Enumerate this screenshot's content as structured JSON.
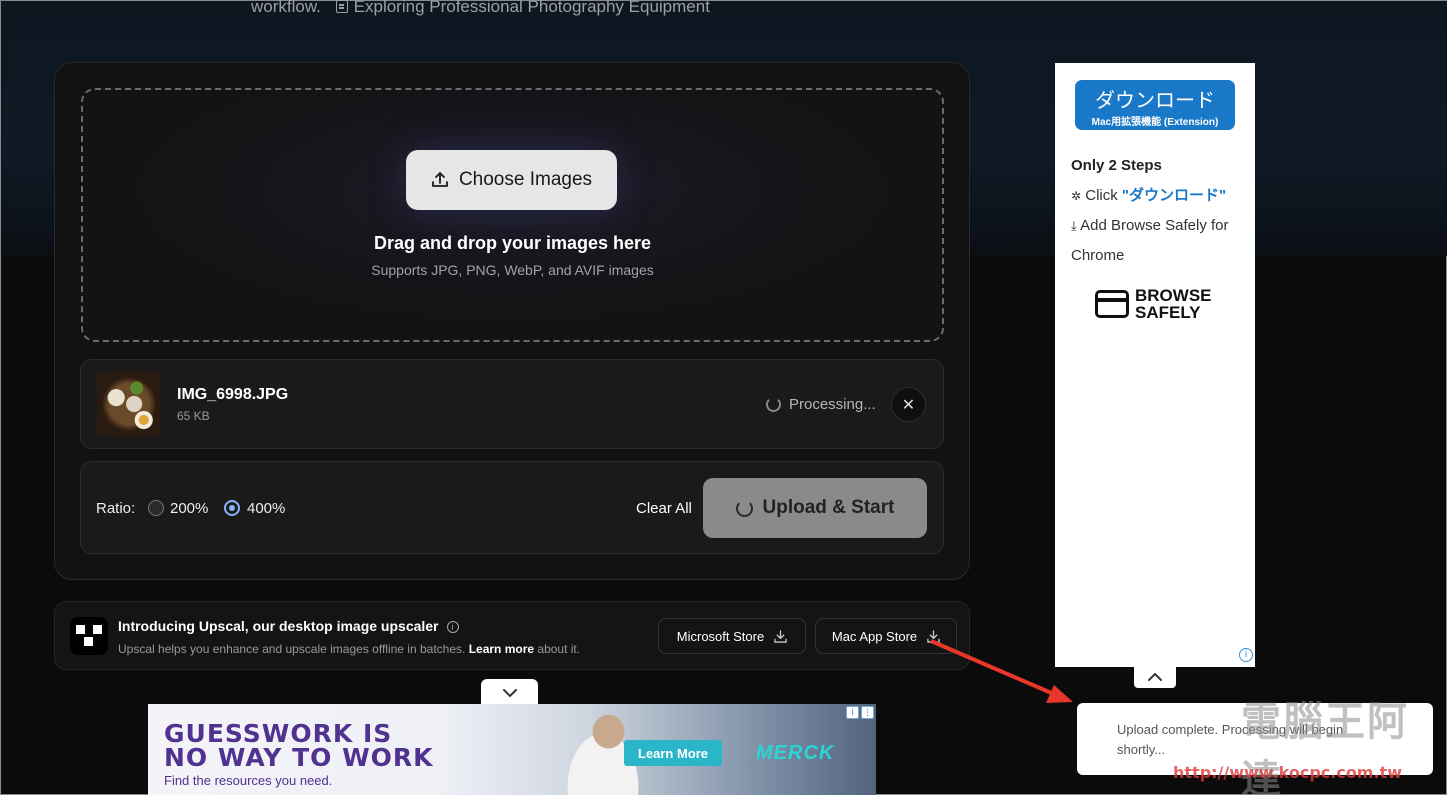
{
  "breadcrumb": {
    "prev": "workflow.",
    "current": "Exploring Professional Photography Equipment"
  },
  "dropzone": {
    "button_label": "Choose Images",
    "title": "Drag and drop your images here",
    "subtitle": "Supports JPG, PNG, WebP, and AVIF images"
  },
  "file": {
    "name": "IMG_6998.JPG",
    "size": "65 KB",
    "status": "Processing..."
  },
  "options": {
    "ratio_label": "Ratio:",
    "ratios": [
      {
        "label": "200%",
        "selected": false
      },
      {
        "label": "400%",
        "selected": true
      }
    ],
    "clear_label": "Clear All",
    "start_label": "Upload & Start"
  },
  "promo": {
    "title": "Introducing Upscal, our desktop image upscaler",
    "sub_prefix": "Upscal helps you enhance and upscale images offline in batches.",
    "learn_more": "Learn more",
    "sub_suffix": "about it.",
    "microsoft_store": "Microsoft Store",
    "mac_app_store": "Mac App Store"
  },
  "side_ad": {
    "download_main": "ダウンロード",
    "download_sub": "Mac用拡張機能 (Extension)",
    "steps_title": "Only 2 Steps",
    "step1_prefix": "Click",
    "step1_highlight": "\"ダウンロード\"",
    "step2": "Add Browse Safely for Chrome",
    "brand_line1": "BROWSE",
    "brand_line2": "SAFELY"
  },
  "bottom_ad": {
    "headline_line1": "GUESSWORK IS",
    "headline_line2": "NO WAY TO WORK",
    "subline": "Find the resources you need.",
    "cta": "Learn More",
    "brand": "MERCK"
  },
  "toast": {
    "message": "Upload complete. Processing will begin shortly..."
  },
  "watermark": {
    "text": "電腦王阿達",
    "url": "http://www.kocpc.com.tw"
  },
  "colors": {
    "accent_blue": "#1a78c8",
    "radio_selected": "#8ab4f8",
    "annotation_arrow": "#e8372a",
    "ad_purple": "#503291"
  }
}
